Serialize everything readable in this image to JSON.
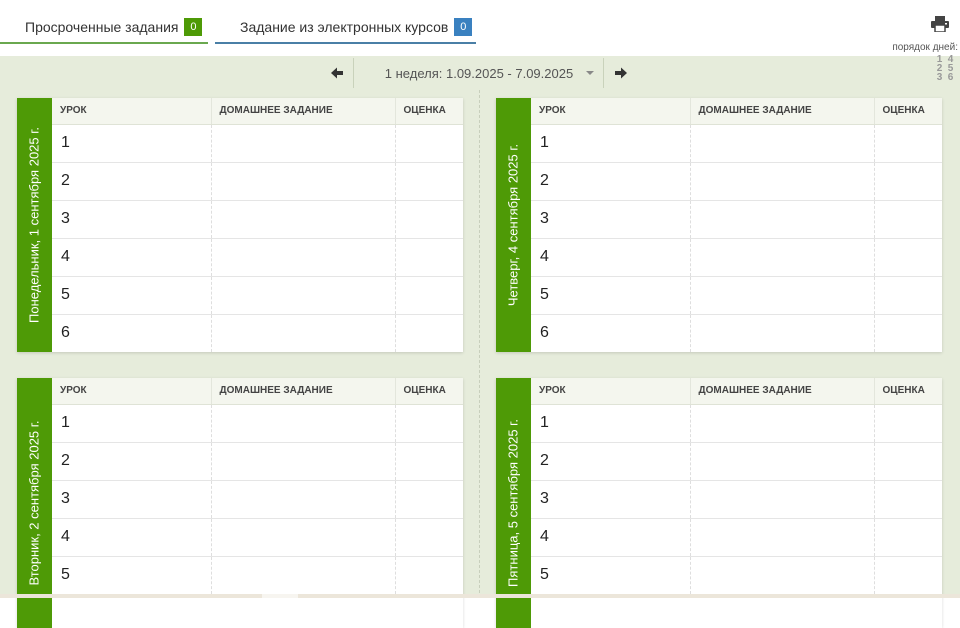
{
  "tabs": [
    {
      "label": "Просроченные задания",
      "count": "0",
      "color": "#4e9a06"
    },
    {
      "label": "Задание из электронных курсов",
      "count": "0",
      "color": "#3a81c0"
    }
  ],
  "toolbar": {
    "print_icon": "printer-icon",
    "order_label": "порядок дней:",
    "order_digits": [
      "1",
      "4",
      "2",
      "5",
      "3",
      "6"
    ]
  },
  "week_nav": {
    "prev_icon": "arrow-left-icon",
    "next_icon": "arrow-right-icon",
    "selected_week": "1 неделя: 1.09.2025 - 7.09.2025"
  },
  "columns": {
    "lesson": "УРОК",
    "homework": "ДОМАШНЕЕ ЗАДАНИЕ",
    "grade": "ОЦЕНКА"
  },
  "days": [
    {
      "title": "Понедельник, 1 сентября 2025 г.",
      "lessons": [
        "1",
        "2",
        "3",
        "4",
        "5",
        "6"
      ]
    },
    {
      "title": "Четверг, 4 сентября 2025 г.",
      "lessons": [
        "1",
        "2",
        "3",
        "4",
        "5",
        "6"
      ]
    },
    {
      "title": "Вторник, 2 сентября 2025 г.",
      "lessons": [
        "1",
        "2",
        "3",
        "4",
        "5"
      ]
    },
    {
      "title": "Пятница, 5 сентября 2025 г.",
      "lessons": [
        "1",
        "2",
        "3",
        "4",
        "5"
      ]
    }
  ],
  "colors": {
    "accent": "#4e9a06",
    "background": "#e6ecdb",
    "header_row": "#f4f6ee"
  }
}
